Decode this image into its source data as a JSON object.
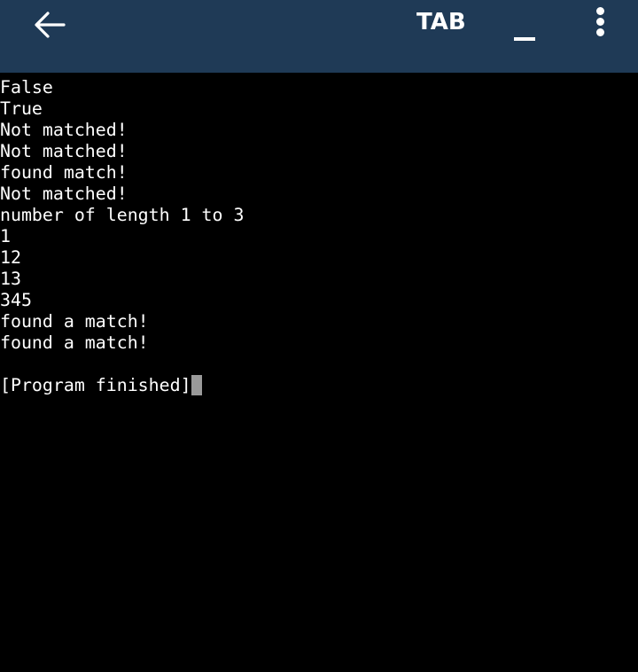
{
  "header": {
    "tab_label": "TAB"
  },
  "terminal": {
    "lines": [
      "False",
      "True",
      "Not matched!",
      "Not matched!",
      "found match!",
      "Not matched!",
      "number of length 1 to 3",
      "1",
      "12",
      "13",
      "345",
      "found a match!",
      "found a match!",
      "",
      "[Program finished]"
    ]
  }
}
